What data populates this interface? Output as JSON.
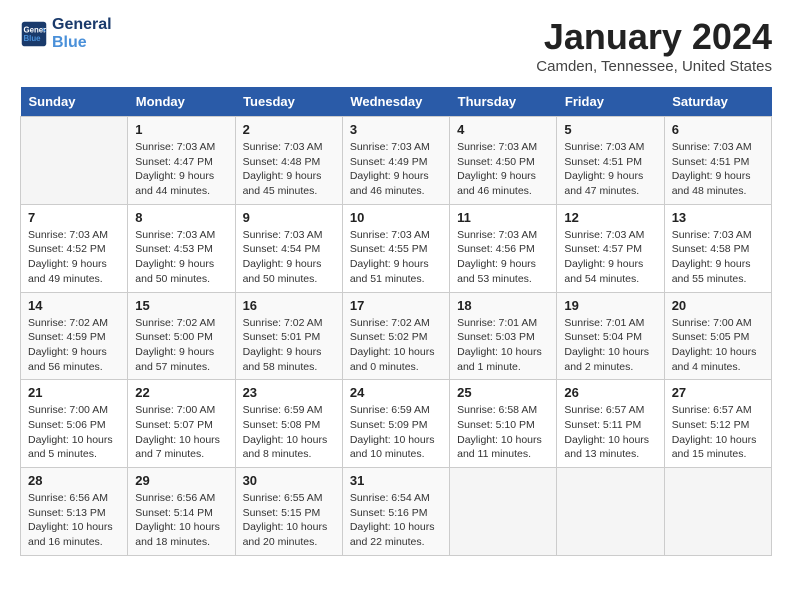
{
  "header": {
    "logo_line1": "General",
    "logo_line2": "Blue",
    "month_year": "January 2024",
    "location": "Camden, Tennessee, United States"
  },
  "weekdays": [
    "Sunday",
    "Monday",
    "Tuesday",
    "Wednesday",
    "Thursday",
    "Friday",
    "Saturday"
  ],
  "weeks": [
    [
      {
        "day": "",
        "empty": true
      },
      {
        "day": "1",
        "sunrise": "7:03 AM",
        "sunset": "4:47 PM",
        "daylight": "9 hours and 44 minutes."
      },
      {
        "day": "2",
        "sunrise": "7:03 AM",
        "sunset": "4:48 PM",
        "daylight": "9 hours and 45 minutes."
      },
      {
        "day": "3",
        "sunrise": "7:03 AM",
        "sunset": "4:49 PM",
        "daylight": "9 hours and 46 minutes."
      },
      {
        "day": "4",
        "sunrise": "7:03 AM",
        "sunset": "4:50 PM",
        "daylight": "9 hours and 46 minutes."
      },
      {
        "day": "5",
        "sunrise": "7:03 AM",
        "sunset": "4:51 PM",
        "daylight": "9 hours and 47 minutes."
      },
      {
        "day": "6",
        "sunrise": "7:03 AM",
        "sunset": "4:51 PM",
        "daylight": "9 hours and 48 minutes."
      }
    ],
    [
      {
        "day": "7",
        "sunrise": "7:03 AM",
        "sunset": "4:52 PM",
        "daylight": "9 hours and 49 minutes."
      },
      {
        "day": "8",
        "sunrise": "7:03 AM",
        "sunset": "4:53 PM",
        "daylight": "9 hours and 50 minutes."
      },
      {
        "day": "9",
        "sunrise": "7:03 AM",
        "sunset": "4:54 PM",
        "daylight": "9 hours and 50 minutes."
      },
      {
        "day": "10",
        "sunrise": "7:03 AM",
        "sunset": "4:55 PM",
        "daylight": "9 hours and 51 minutes."
      },
      {
        "day": "11",
        "sunrise": "7:03 AM",
        "sunset": "4:56 PM",
        "daylight": "9 hours and 53 minutes."
      },
      {
        "day": "12",
        "sunrise": "7:03 AM",
        "sunset": "4:57 PM",
        "daylight": "9 hours and 54 minutes."
      },
      {
        "day": "13",
        "sunrise": "7:03 AM",
        "sunset": "4:58 PM",
        "daylight": "9 hours and 55 minutes."
      }
    ],
    [
      {
        "day": "14",
        "sunrise": "7:02 AM",
        "sunset": "4:59 PM",
        "daylight": "9 hours and 56 minutes."
      },
      {
        "day": "15",
        "sunrise": "7:02 AM",
        "sunset": "5:00 PM",
        "daylight": "9 hours and 57 minutes."
      },
      {
        "day": "16",
        "sunrise": "7:02 AM",
        "sunset": "5:01 PM",
        "daylight": "9 hours and 58 minutes."
      },
      {
        "day": "17",
        "sunrise": "7:02 AM",
        "sunset": "5:02 PM",
        "daylight": "10 hours and 0 minutes."
      },
      {
        "day": "18",
        "sunrise": "7:01 AM",
        "sunset": "5:03 PM",
        "daylight": "10 hours and 1 minute."
      },
      {
        "day": "19",
        "sunrise": "7:01 AM",
        "sunset": "5:04 PM",
        "daylight": "10 hours and 2 minutes."
      },
      {
        "day": "20",
        "sunrise": "7:00 AM",
        "sunset": "5:05 PM",
        "daylight": "10 hours and 4 minutes."
      }
    ],
    [
      {
        "day": "21",
        "sunrise": "7:00 AM",
        "sunset": "5:06 PM",
        "daylight": "10 hours and 5 minutes."
      },
      {
        "day": "22",
        "sunrise": "7:00 AM",
        "sunset": "5:07 PM",
        "daylight": "10 hours and 7 minutes."
      },
      {
        "day": "23",
        "sunrise": "6:59 AM",
        "sunset": "5:08 PM",
        "daylight": "10 hours and 8 minutes."
      },
      {
        "day": "24",
        "sunrise": "6:59 AM",
        "sunset": "5:09 PM",
        "daylight": "10 hours and 10 minutes."
      },
      {
        "day": "25",
        "sunrise": "6:58 AM",
        "sunset": "5:10 PM",
        "daylight": "10 hours and 11 minutes."
      },
      {
        "day": "26",
        "sunrise": "6:57 AM",
        "sunset": "5:11 PM",
        "daylight": "10 hours and 13 minutes."
      },
      {
        "day": "27",
        "sunrise": "6:57 AM",
        "sunset": "5:12 PM",
        "daylight": "10 hours and 15 minutes."
      }
    ],
    [
      {
        "day": "28",
        "sunrise": "6:56 AM",
        "sunset": "5:13 PM",
        "daylight": "10 hours and 16 minutes."
      },
      {
        "day": "29",
        "sunrise": "6:56 AM",
        "sunset": "5:14 PM",
        "daylight": "10 hours and 18 minutes."
      },
      {
        "day": "30",
        "sunrise": "6:55 AM",
        "sunset": "5:15 PM",
        "daylight": "10 hours and 20 minutes."
      },
      {
        "day": "31",
        "sunrise": "6:54 AM",
        "sunset": "5:16 PM",
        "daylight": "10 hours and 22 minutes."
      },
      {
        "day": "",
        "empty": true
      },
      {
        "day": "",
        "empty": true
      },
      {
        "day": "",
        "empty": true
      }
    ]
  ]
}
